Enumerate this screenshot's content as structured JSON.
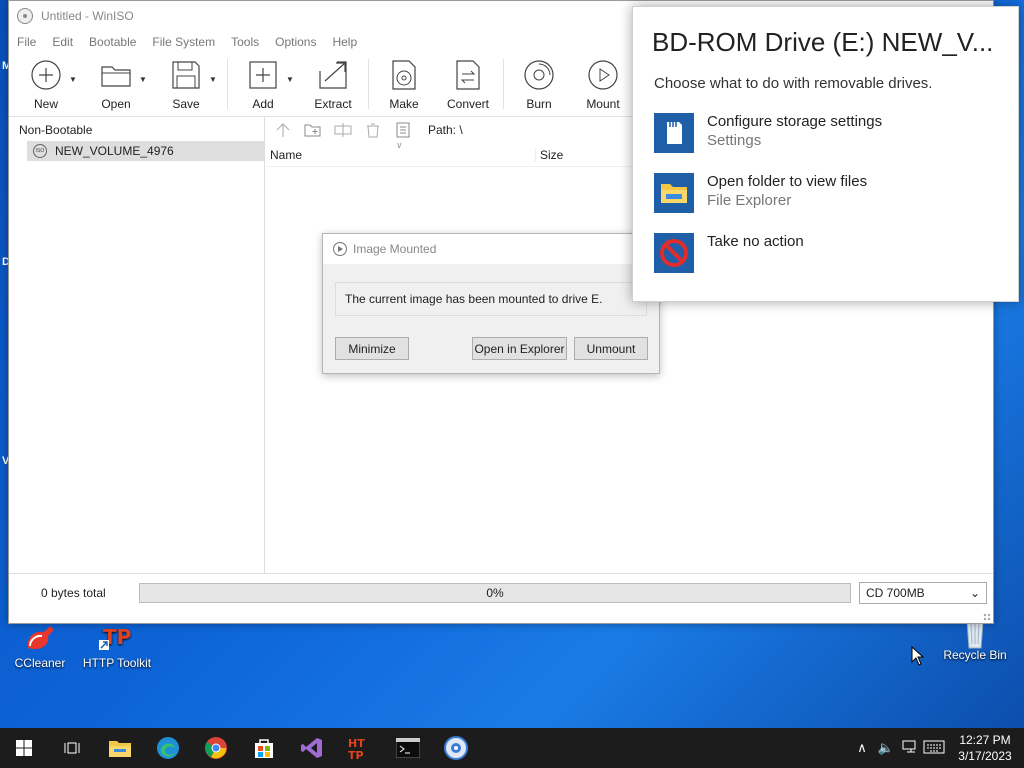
{
  "winiso": {
    "title": "Untitled - WinISO",
    "menu": [
      "File",
      "Edit",
      "Bootable",
      "File System",
      "Tools",
      "Options",
      "Help"
    ],
    "toolbar": {
      "new": "New",
      "open": "Open",
      "save": "Save",
      "add": "Add",
      "extract": "Extract",
      "make": "Make",
      "convert": "Convert",
      "burn": "Burn",
      "mount": "Mount"
    },
    "tree": {
      "root": "Non-Bootable",
      "volume": "NEW_VOLUME_4976",
      "iso_badge": "ISO"
    },
    "filelist": {
      "path_label": "Path: \\",
      "col_name": "Name",
      "col_size": "Size"
    },
    "status": {
      "bytes": "0 bytes total",
      "progress": "0%",
      "progress_value": 0,
      "media": "CD 700MB"
    }
  },
  "dialog": {
    "title": "Image Mounted",
    "message": "The current image has been mounted to drive E.",
    "minimize": "Minimize",
    "open_explorer": "Open in Explorer",
    "unmount": "Unmount"
  },
  "autoplay": {
    "title": "BD-ROM Drive (E:) NEW_V...",
    "subtitle": "Choose what to do with removable drives.",
    "options": [
      {
        "main": "Configure storage settings",
        "desc": "Settings",
        "icon": "sd-card-icon"
      },
      {
        "main": "Open folder to view files",
        "desc": "File Explorer",
        "icon": "folder-icon"
      },
      {
        "main": "Take no action",
        "desc": "",
        "icon": "no-action-icon"
      }
    ]
  },
  "desktop": {
    "icons": [
      {
        "label": "CCleaner"
      },
      {
        "label": "HTTP Toolkit"
      },
      {
        "label": "Recycle Bin"
      }
    ],
    "edge_letters": [
      "M",
      "D",
      "V"
    ]
  },
  "taskbar": {
    "time": "12:27 PM",
    "date": "3/17/2023",
    "http_badge": "HT\nTP"
  },
  "colors": {
    "accent": "#1e5fa8",
    "taskbar": "#1c1c1c"
  }
}
